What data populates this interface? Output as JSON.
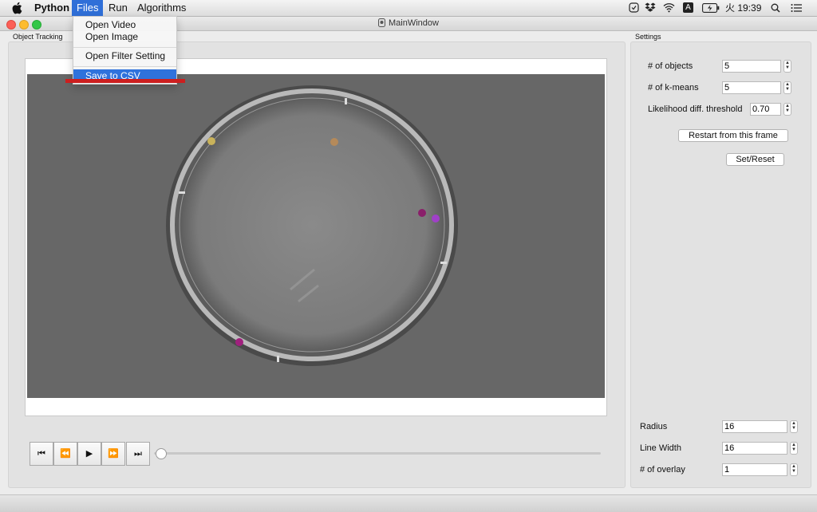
{
  "menubar": {
    "app_name": "Python",
    "items": [
      "Files",
      "Run",
      "Algorithms"
    ],
    "active_item": "Files",
    "status": {
      "input_badge": "A",
      "clock": "火 19:39"
    }
  },
  "window": {
    "title": "MainWindow"
  },
  "files_menu": {
    "items": [
      {
        "label": "Open Video"
      },
      {
        "label": "Open Image"
      },
      {
        "label": "Open Filter Setting"
      },
      {
        "label": "Save to CSV"
      }
    ],
    "highlighted": "Save to CSV"
  },
  "object_tracking": {
    "label": "Object Tracking"
  },
  "settings": {
    "label": "Settings",
    "num_objects": {
      "label": "# of objects",
      "value": "5"
    },
    "num_kmeans": {
      "label": "# of k-means",
      "value": "5"
    },
    "likelihood": {
      "label": "Likelihood diff. threshold",
      "value": "0.70"
    },
    "restart_button": "Restart from this frame",
    "set_reset_button": "Set/Reset",
    "radius": {
      "label": "Radius",
      "value": "16"
    },
    "line_width": {
      "label": "Line Width",
      "value": "16"
    },
    "num_overlay": {
      "label": "# of overlay",
      "value": "1"
    }
  },
  "playback": {
    "buttons": [
      {
        "name": "skip-to-start",
        "glyph": "⏮"
      },
      {
        "name": "rewind",
        "glyph": "⏪"
      },
      {
        "name": "play",
        "glyph": "▶"
      },
      {
        "name": "fast-forward",
        "glyph": "⏩"
      },
      {
        "name": "skip-to-end",
        "glyph": "⏭"
      }
    ],
    "position": 0
  },
  "colors": {
    "menu_highlight": "#2f72dc",
    "annotation_underline": "#cc1f1f"
  }
}
